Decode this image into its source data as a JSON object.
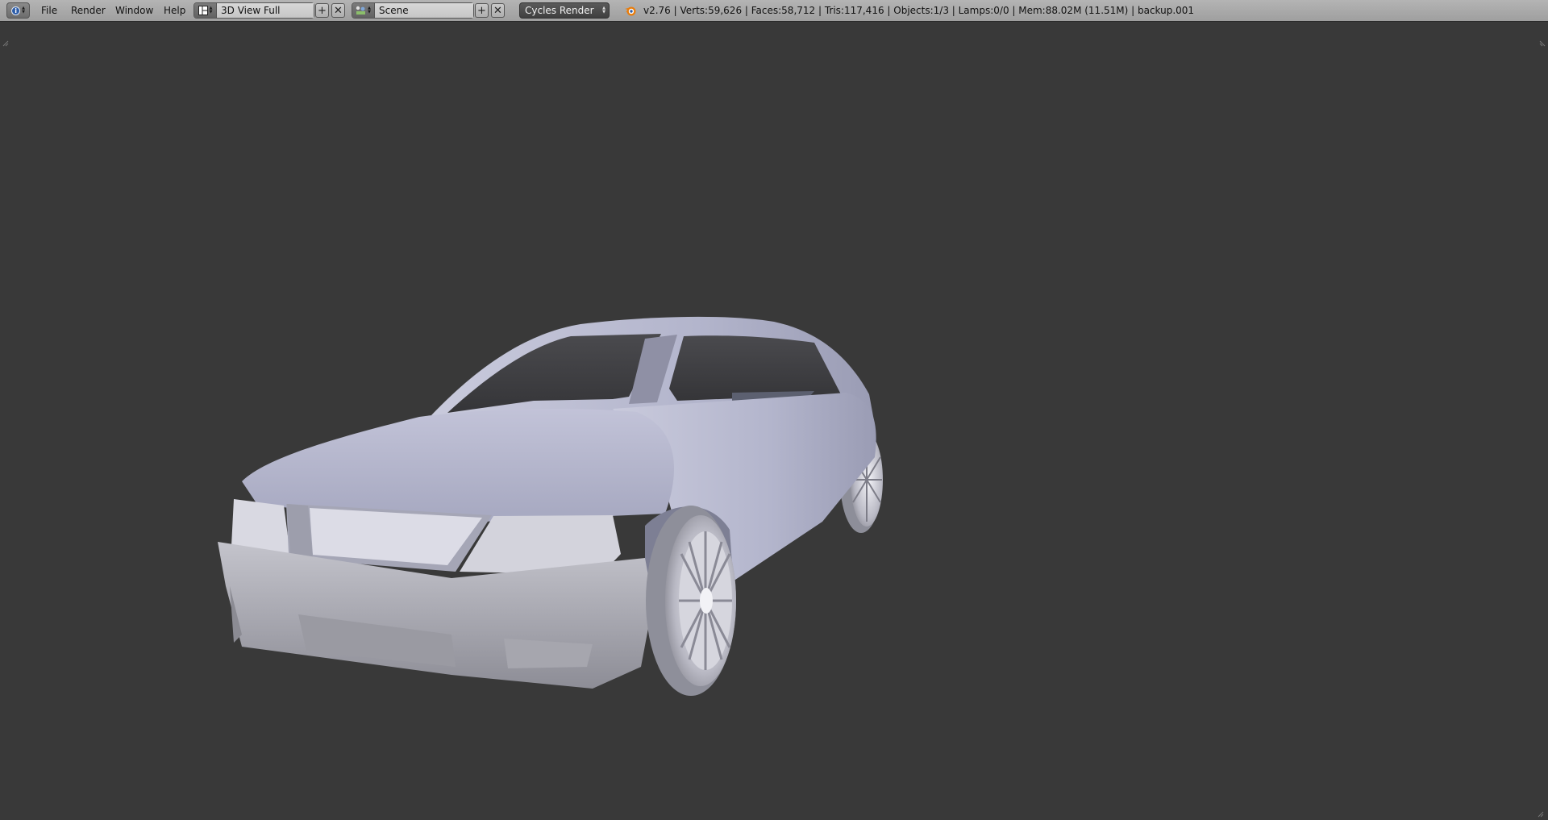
{
  "header": {
    "editor_type_icon": "info-icon",
    "menus": [
      "File",
      "Render",
      "Window",
      "Help"
    ],
    "screen_layout": {
      "icon": "screen-layout-icon",
      "value": "3D View Full"
    },
    "scene": {
      "icon": "scene-icon",
      "value": "Scene"
    },
    "render_engine": "Cycles Render",
    "stats": "v2.76 | Verts:59,626 | Faces:58,712 | Tris:117,416 | Objects:1/3 | Lamps:0/0 | Mem:88.02M (11.51M) | backup.001"
  },
  "viewport": {
    "background": "#393939",
    "object": "car-mesh",
    "shading": "solid",
    "mesh_color": "#bfc0d4"
  },
  "colors": {
    "header_bg": "#a9a9a9",
    "engine_bg": "#4a4a4a",
    "logo_orange": "#e87d0d",
    "info_blue": "#2d5da8"
  }
}
